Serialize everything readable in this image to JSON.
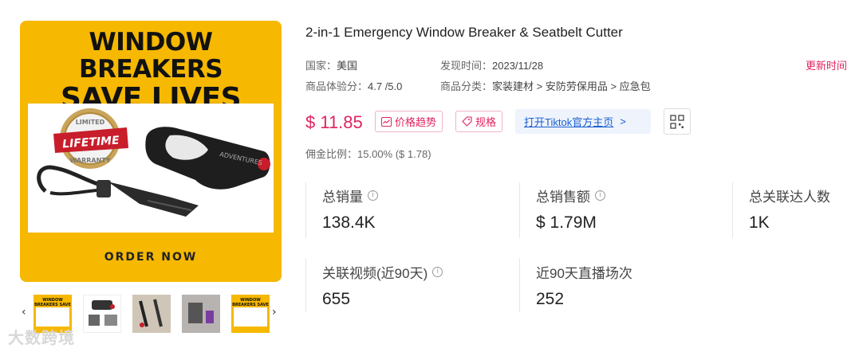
{
  "product": {
    "title": "2-in-1 Emergency Window Breaker & Seatbelt Cutter",
    "image_headline_1": "WINDOW BREAKERS",
    "image_headline_2": "SAVE LIVES",
    "image_seal_top": "LIMITED",
    "image_seal_mid": "LIFETIME",
    "image_seal_bottom": "WARRANTY",
    "image_device_text": "ADVENTURES",
    "image_cta": "ORDER NOW"
  },
  "thumbnails": [
    {
      "caption": "WINDOW BREAKERS SAVE LIVES",
      "style": "yellow"
    },
    {
      "caption": "",
      "style": "white"
    },
    {
      "caption": "",
      "style": "photo"
    },
    {
      "caption": "",
      "style": "photo"
    },
    {
      "caption": "WINDOW BREAKERS SAVE LIVES",
      "style": "yellow"
    }
  ],
  "watermark": "大数跨境",
  "meta": {
    "country_label": "国家：",
    "country_value": "美国",
    "discover_label": "发现时间：",
    "discover_value": "2023/11/28",
    "rating_label": "商品体验分：",
    "rating_value": "4.7 /5.0",
    "category_label": "商品分类：",
    "category_value": "家装建材 > 安防劳保用品 > 应急包",
    "update_link": "更新时间"
  },
  "price": "$ 11.85",
  "buttons": {
    "price_trend": "价格趋势",
    "spec": "规格",
    "tiktok": "打开Tiktok官方主页",
    "tiktok_chevron": ">"
  },
  "commission": {
    "label": "佣金比例：",
    "value": "15.00% ($ 1.78)"
  },
  "stats": {
    "total_sales_label": "总销量",
    "total_sales_value": "138.4K",
    "total_revenue_label": "总销售额",
    "total_revenue_value": "$ 1.79M",
    "total_creators_label": "总关联达人数",
    "total_creators_value": "1K",
    "videos_label": "关联视频(近90天)",
    "videos_value": "655",
    "live_label": "近90天直播场次",
    "live_value": "252"
  },
  "colors": {
    "accent": "#e0245e",
    "link_blue": "#1a5fd0",
    "image_yellow": "#f6b800"
  }
}
